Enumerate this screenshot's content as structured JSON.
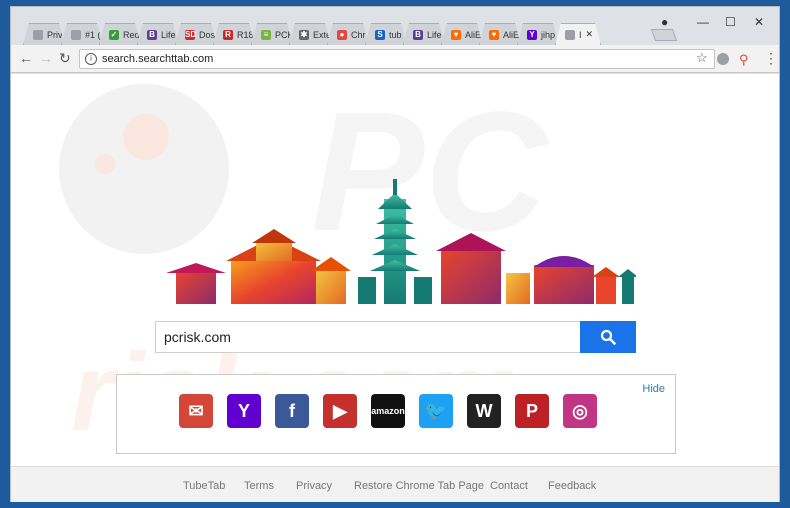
{
  "tabs": [
    {
      "label": "Priv",
      "color": "#9aa0a6",
      "glyph": ""
    },
    {
      "label": "#1 (",
      "color": "#9aa0a6",
      "glyph": ""
    },
    {
      "label": "Red",
      "color": "#3a9b3a",
      "glyph": "✓"
    },
    {
      "label": "Life",
      "color": "#5b3f94",
      "glyph": "B"
    },
    {
      "label": "Dos",
      "color": "#d9262b",
      "glyph": "SD"
    },
    {
      "label": "R18",
      "color": "#c62828",
      "glyph": "R"
    },
    {
      "label": "PCK",
      "color": "#7cb342",
      "glyph": "≡"
    },
    {
      "label": "Exte",
      "color": "#666666",
      "glyph": "✱"
    },
    {
      "label": "Chr",
      "color": "#e8453c",
      "glyph": "●"
    },
    {
      "label": "tub",
      "color": "#1565c0",
      "glyph": "S"
    },
    {
      "label": "Life",
      "color": "#5b3f94",
      "glyph": "B"
    },
    {
      "label": "AliE",
      "color": "#ff6a00",
      "glyph": "♥"
    },
    {
      "label": "AliE",
      "color": "#ff6a00",
      "glyph": "♥"
    },
    {
      "label": "jihp",
      "color": "#6001d2",
      "glyph": "Y"
    },
    {
      "label": "I",
      "color": "#9aa0a6",
      "glyph": ""
    }
  ],
  "address": {
    "url": "search.searchttab.com"
  },
  "search": {
    "value": "pcrisk.com"
  },
  "tiles": {
    "hide_label": "Hide",
    "items": [
      {
        "name": "gmail",
        "color": "#d44638",
        "glyph": "✉"
      },
      {
        "name": "yahoo",
        "color": "#6001d2",
        "glyph": "Y"
      },
      {
        "name": "facebook",
        "color": "#3b5998",
        "glyph": "f"
      },
      {
        "name": "youtube",
        "color": "#c4302b",
        "glyph": "▶"
      },
      {
        "name": "amazon",
        "color": "#111111",
        "glyph": "amazon"
      },
      {
        "name": "twitter",
        "color": "#1da1f2",
        "glyph": "🐦"
      },
      {
        "name": "wikipedia",
        "color": "#222222",
        "glyph": "W"
      },
      {
        "name": "pinterest",
        "color": "#bd2125",
        "glyph": "P"
      },
      {
        "name": "instagram",
        "color": "#c13584",
        "glyph": "◎"
      }
    ]
  },
  "footer": {
    "links": [
      "TubeTab",
      "Terms",
      "Privacy",
      "Restore Chrome Tab Page",
      "Contact",
      "Feedback"
    ]
  },
  "colors": {
    "accent": "#1a73e8",
    "link": "#2a7ab6"
  }
}
